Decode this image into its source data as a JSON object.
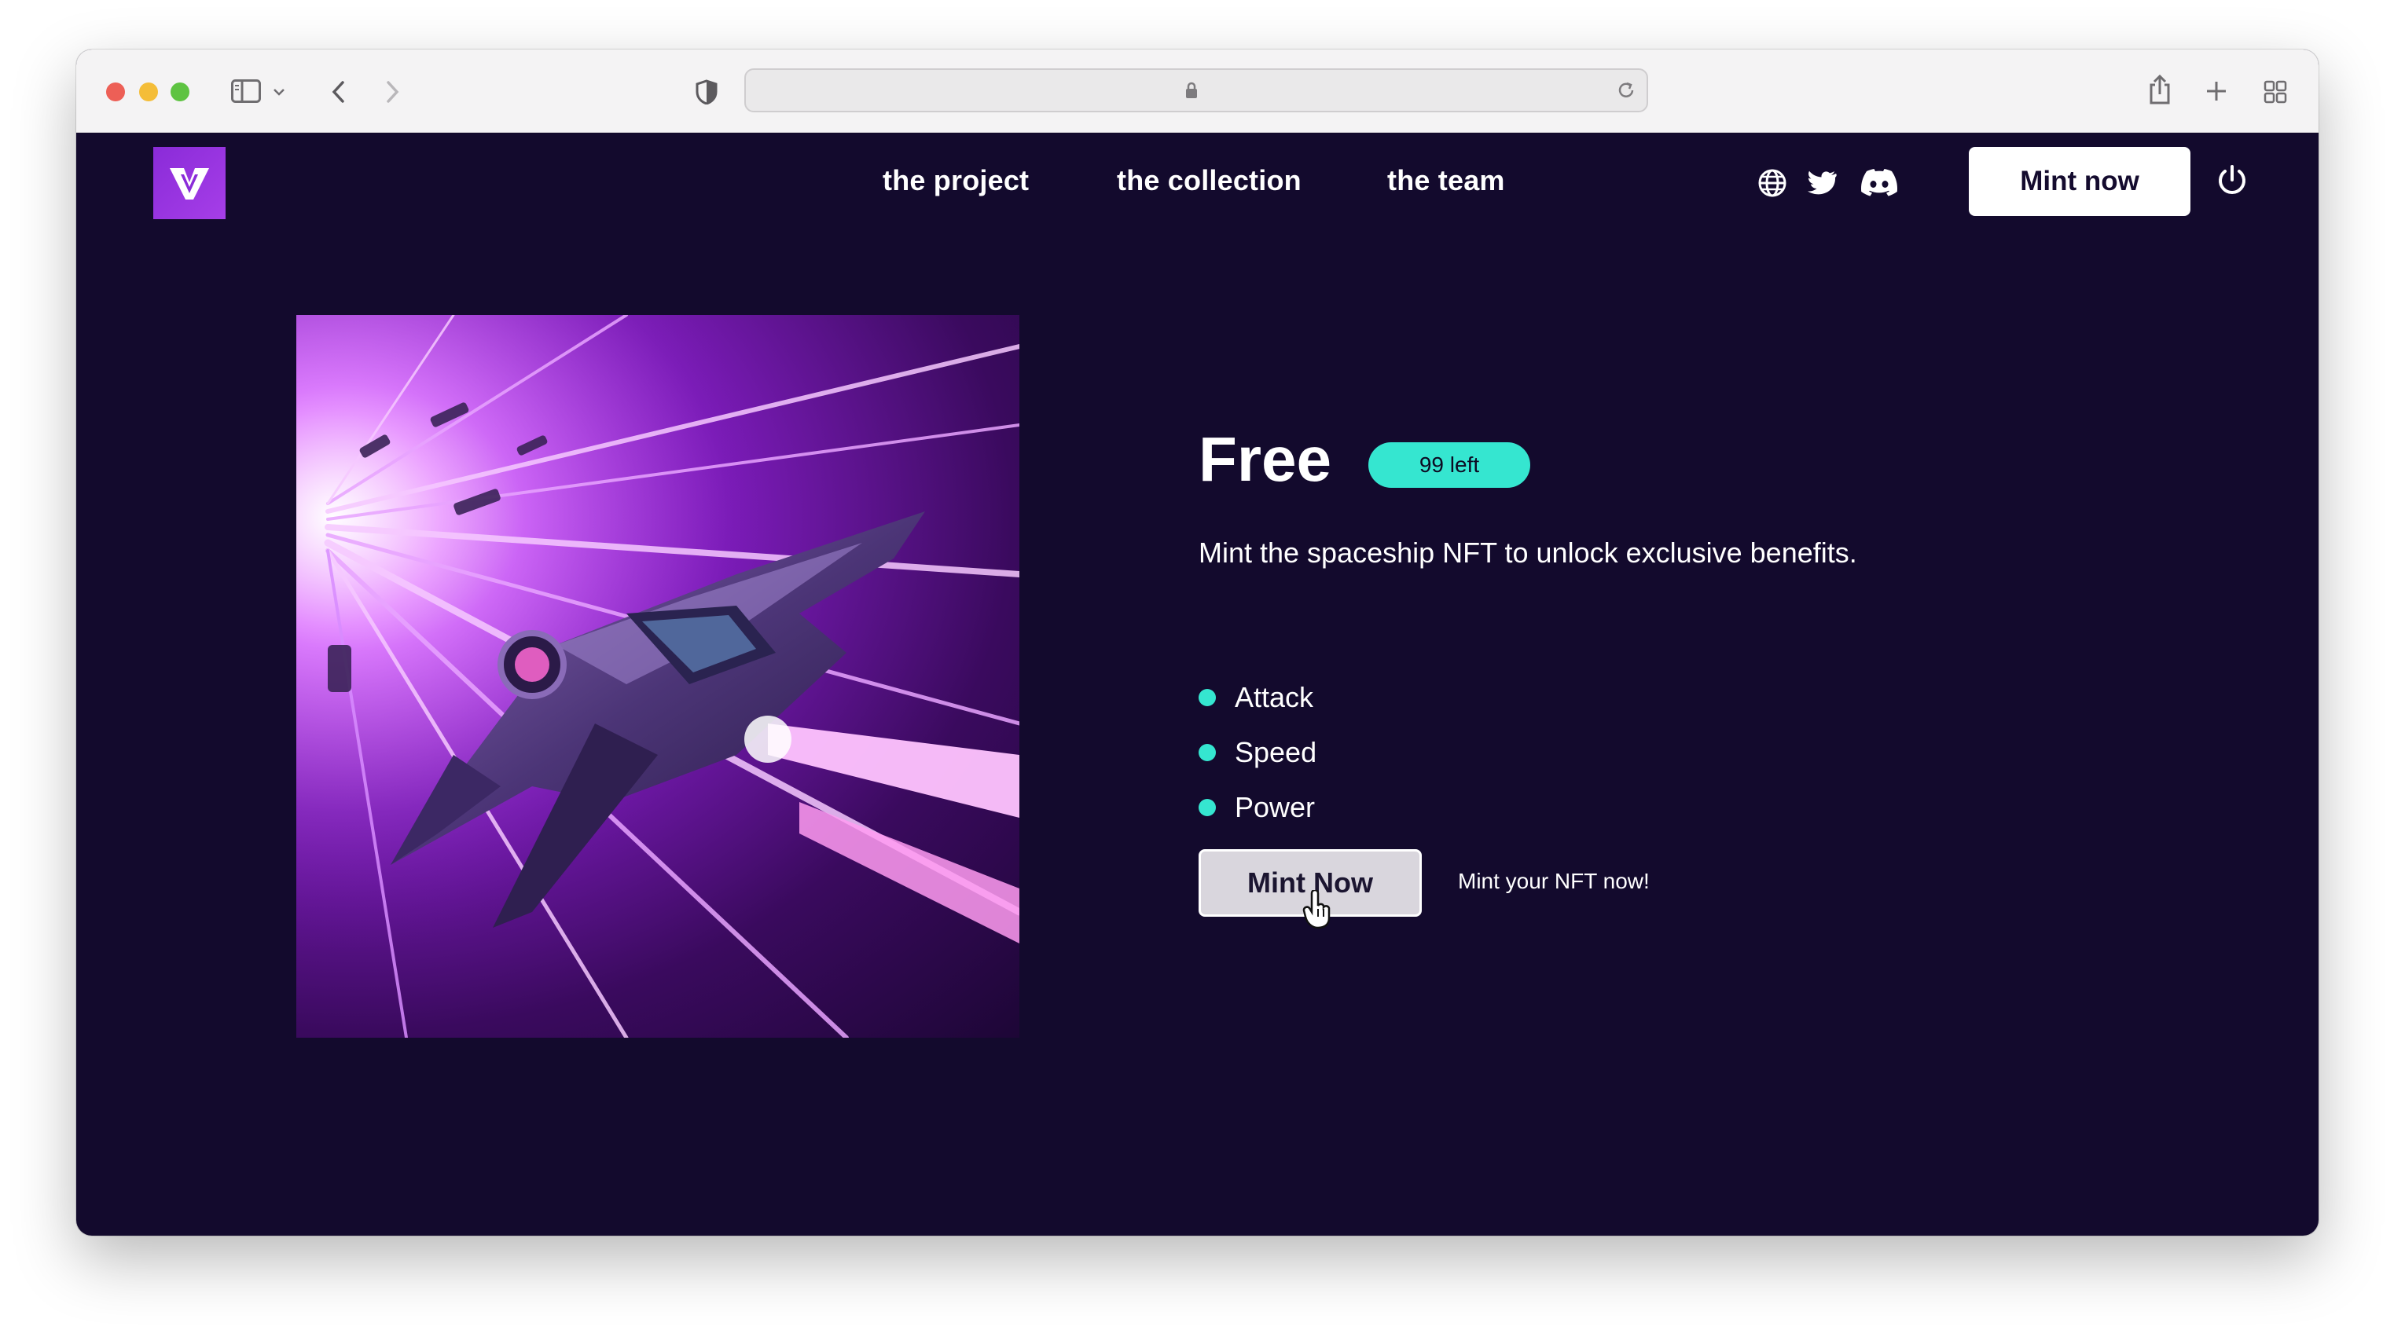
{
  "browser": {
    "buttons": [
      "sidebar-toggle",
      "back",
      "forward",
      "privacy-shield",
      "share",
      "new-tab",
      "tab-overview"
    ],
    "url": ""
  },
  "nav": {
    "logo_letter": "V",
    "links": [
      "the project",
      "the collection",
      "the team"
    ],
    "social_icons": [
      "globe-icon",
      "twitter-icon",
      "discord-icon"
    ],
    "mint_button": "Mint now"
  },
  "hero": {
    "price": "Free",
    "badge": "99 left",
    "description": "Mint the spaceship NFT to unlock exclusive benefits.",
    "benefits": [
      "Attack",
      "Speed",
      "Power"
    ],
    "mint_button": "Mint Now",
    "hint": "Mint your NFT now!"
  },
  "colors": {
    "page_bg": "#130a2d",
    "accent_teal": "#35e6d0",
    "logo_purple": "#8a2bd8"
  }
}
